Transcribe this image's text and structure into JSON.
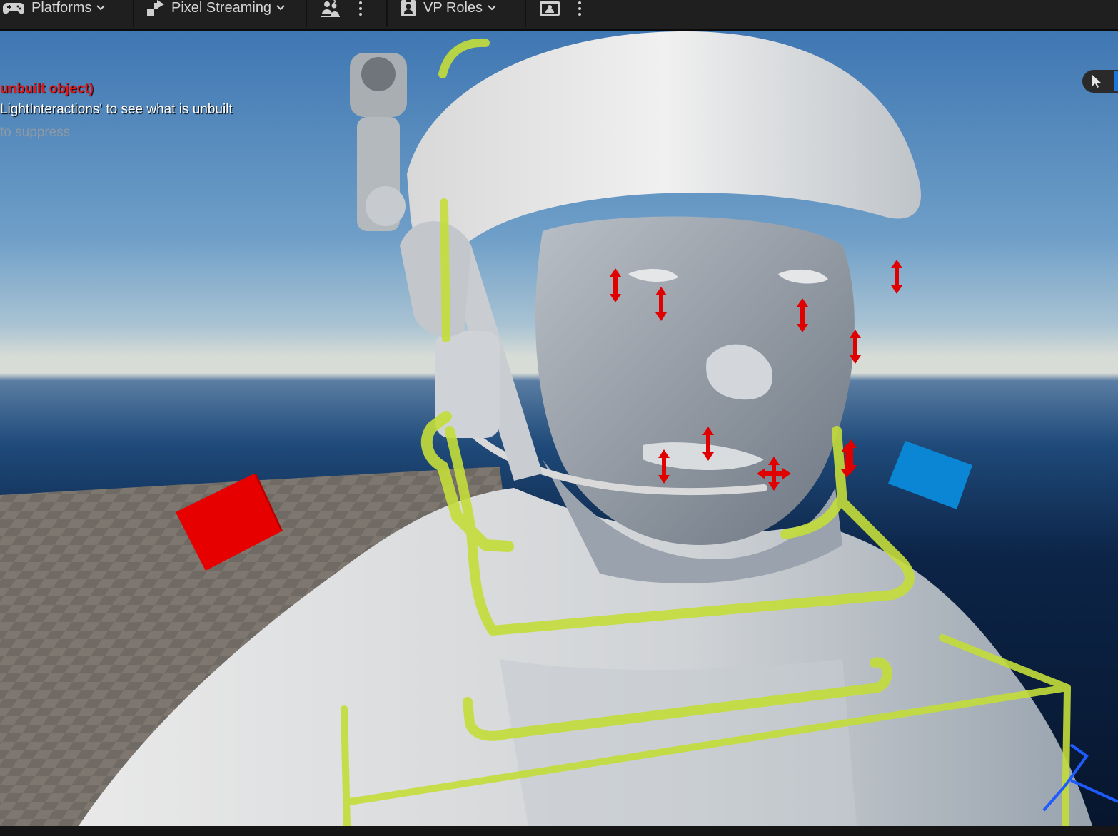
{
  "toolbar": {
    "platforms_label": "Platforms",
    "pixel_streaming_label": "Pixel Streaming",
    "vp_roles_label": "VP Roles"
  },
  "messages": {
    "error": "unbuilt object)",
    "info": "LightInteractions' to see what is unbuilt",
    "hint": "to suppress"
  },
  "icons": {
    "platforms": "gamepad-icon",
    "pixel_streaming": "pixel-streaming-icon",
    "multi_user": "users-icon",
    "vp_roles": "vp-roles-icon",
    "camera": "camera-monitor-icon",
    "select_mode": "cursor-arrow-icon"
  },
  "colors": {
    "selection_outline": "#c4dd3a",
    "control_red": "#e60000",
    "control_blue": "#0a86d4",
    "arrow_red": "#e00000",
    "accent": "#1a74d9"
  }
}
